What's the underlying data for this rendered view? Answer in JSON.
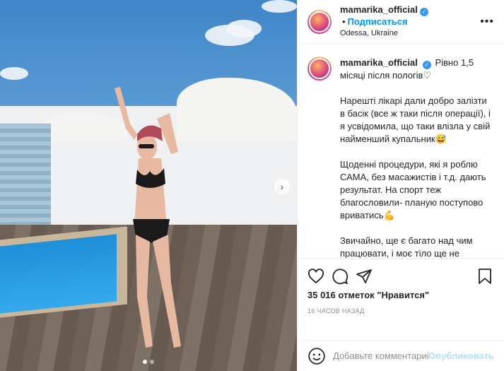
{
  "header": {
    "username": "mamarika_official",
    "separator": "•",
    "follow_label": "Подписаться",
    "location": "Odessa, Ukraine",
    "more_label": "•••"
  },
  "caption": {
    "username": "mamarika_official",
    "paragraphs": [
      "Рівно 1,5 місяці після пологів♡",
      "Нарешті лікарі дали добро залізти в басік (все ж таки після операції), і я усвідомила, що таки влізла у свій найменший купальник😅",
      "Щоденні процедури, які я роблю САМА, без масажистів і т.д. дають результат. На спорт теж благословили- планую поступово вриватись💪",
      "Звичайно, ще є багато над чим працювати, і моє тіло ще не прийшло в мою ідеальну форму.По-чеснoку, кілька зайвих кг ще гуляють, а точніше цілих 4🙈Але на даний момент я собою задоволена,"
    ]
  },
  "actions": {
    "likes": "35 016 отметок \"Нравится\"",
    "time": "16 часов назад"
  },
  "comment": {
    "placeholder": "Добавьте комментарий...",
    "post_label": "Опубликовать"
  },
  "photo": {
    "slide_index": 1,
    "slide_count": 2
  },
  "colors": {
    "accent": "#0095f6",
    "verified": "#3897f0"
  }
}
